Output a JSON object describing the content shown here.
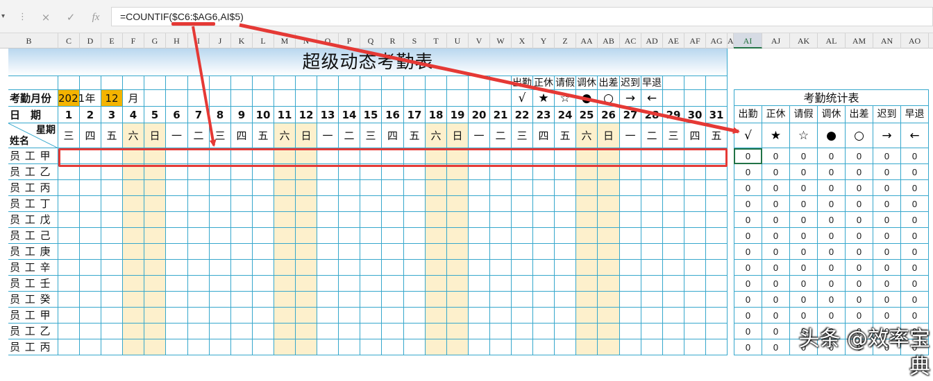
{
  "formula_bar": {
    "cancel_icon": "×",
    "enter_icon": "✓",
    "fx_label": "fx",
    "formula": "=COUNTIF($C6:$AG6,AI$5)"
  },
  "columns": {
    "left": [
      "B",
      "C",
      "D",
      "E",
      "F",
      "G",
      "H",
      "I",
      "J",
      "K",
      "L",
      "M",
      "N",
      "O",
      "P",
      "Q",
      "R",
      "S",
      "T",
      "U",
      "V",
      "W",
      "X",
      "Y",
      "Z",
      "AA",
      "AB",
      "AC",
      "AD",
      "AE",
      "AF",
      "AG",
      "A"
    ],
    "right": [
      "AI",
      "AJ",
      "AK",
      "AL",
      "AM",
      "AN",
      "AO"
    ],
    "selected": "AI"
  },
  "sheet": {
    "title": "超级动态考勤表",
    "month_label": "考勤月份",
    "year": "2021",
    "year_unit": "年",
    "month": "12",
    "month_unit": "月",
    "date_label": "日　期",
    "week_label": "星期",
    "name_label": "姓名",
    "legend_labels": [
      "出勤",
      "正休",
      "请假",
      "调休",
      "出差",
      "迟到",
      "早退"
    ],
    "legend_symbols": [
      "√",
      "★",
      "☆",
      "●",
      "○",
      "→",
      "←"
    ],
    "days": [
      "1",
      "2",
      "3",
      "4",
      "5",
      "6",
      "7",
      "8",
      "9",
      "10",
      "11",
      "12",
      "13",
      "14",
      "15",
      "16",
      "17",
      "18",
      "19",
      "20",
      "21",
      "22",
      "23",
      "24",
      "25",
      "26",
      "27",
      "28",
      "29",
      "30",
      "31"
    ],
    "weekdays": [
      "三",
      "四",
      "五",
      "六",
      "日",
      "一",
      "二",
      "三",
      "四",
      "五",
      "六",
      "日",
      "一",
      "二",
      "三",
      "四",
      "五",
      "六",
      "日",
      "一",
      "二",
      "三",
      "四",
      "五",
      "六",
      "日",
      "一",
      "二",
      "三",
      "四",
      "五"
    ],
    "employees": [
      "员 工 甲",
      "员 工 乙",
      "员 工 丙",
      "员 工 丁",
      "员 工 戊",
      "员 工 己",
      "员 工 庚",
      "员 工 辛",
      "员 工 壬",
      "员 工 癸",
      "员 工 甲",
      "员 工 乙",
      "员 工 丙"
    ]
  },
  "stats": {
    "title": "考勤统计表",
    "headers": [
      "出勤",
      "正休",
      "请假",
      "调休",
      "出差",
      "迟到",
      "早退"
    ],
    "symbols": [
      "√",
      "★",
      "☆",
      "●",
      "○",
      "→",
      "←"
    ],
    "value": "0"
  },
  "colors": {
    "grid": "#35a7cc",
    "weekend_fill": "#fdf0cc",
    "highlight_fill": "#f4b400",
    "annotation": "#e53935"
  },
  "watermark": "头条 @效率宝典"
}
